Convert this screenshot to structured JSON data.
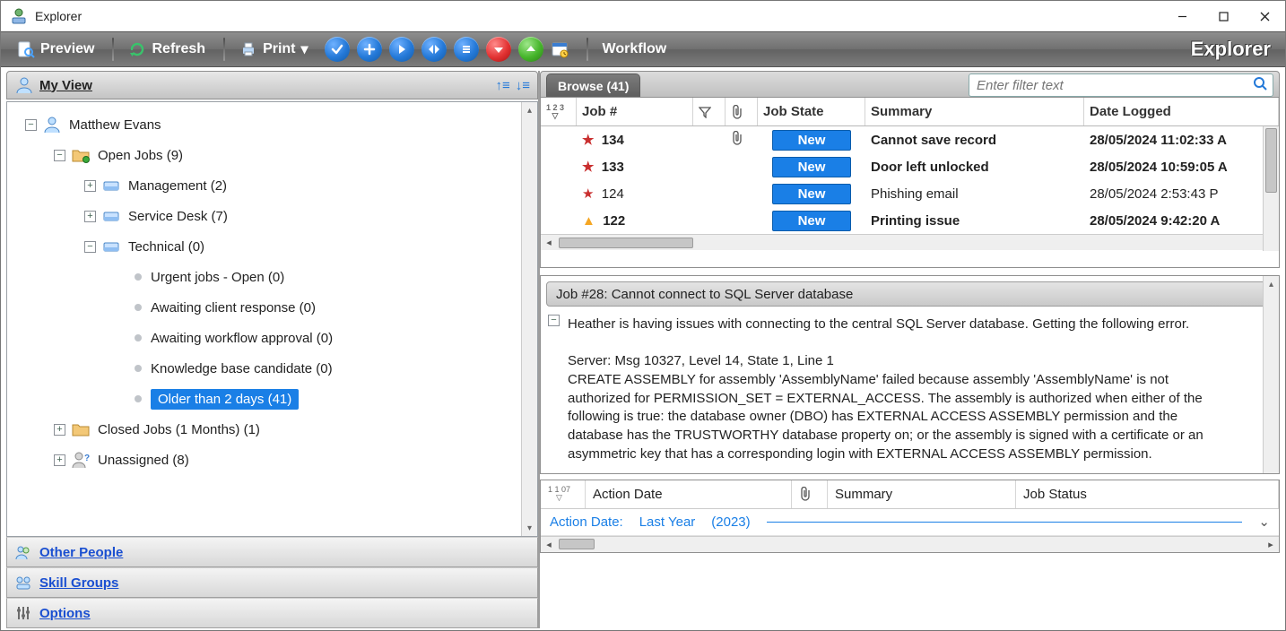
{
  "titlebar": {
    "title": "Explorer"
  },
  "toolbar": {
    "preview": "Preview",
    "refresh": "Refresh",
    "print": "Print",
    "workflow": "Workflow",
    "brand": "Explorer"
  },
  "sidebar": {
    "myview": {
      "label": "My View",
      "key": "M"
    },
    "user": "Matthew Evans",
    "open_jobs": "Open Jobs (9)",
    "management": "Management (2)",
    "service_desk": "Service Desk (7)",
    "technical": "Technical (0)",
    "tech_children": {
      "urgent": "Urgent jobs - Open (0)",
      "awaiting_client": "Awaiting client response (0)",
      "awaiting_wf": "Awaiting workflow approval (0)",
      "kb": "Knowledge base candidate (0)",
      "older": "Older than 2 days (41)"
    },
    "closed": "Closed Jobs (1 Months) (1)",
    "unassigned": "Unassigned (8)",
    "other_people": "Other People",
    "skill_groups": "Skill Groups",
    "options": "Options"
  },
  "browse": {
    "tab": "Browse (41)",
    "filter_placeholder": "Enter filter text",
    "cols": {
      "job": "Job #",
      "state": "Job State",
      "summary": "Summary",
      "date": "Date Logged"
    },
    "rows": [
      {
        "flag": "star",
        "job": "134",
        "clip": true,
        "state": "New",
        "summary": "Cannot save record",
        "date": "28/05/2024 11:02:33 A",
        "bold": true
      },
      {
        "flag": "star",
        "job": "133",
        "clip": false,
        "state": "New",
        "summary": "Door left unlocked",
        "date": "28/05/2024 10:59:05 A",
        "bold": true
      },
      {
        "flag": "star",
        "job": "124",
        "clip": false,
        "state": "New",
        "summary": "Phishing email",
        "date": "28/05/2024 2:53:43 P",
        "bold": false
      },
      {
        "flag": "warn",
        "job": "122",
        "clip": false,
        "state": "New",
        "summary": "Printing issue",
        "date": "28/05/2024 9:42:20 A",
        "bold": true
      }
    ]
  },
  "detail": {
    "title": "Job #28: Cannot connect to SQL Server database",
    "para1": "Heather is having issues with connecting to the central SQL Server database.   Getting the following error.",
    "para2": "Server: Msg 10327, Level 14, State 1, Line 1",
    "para3": "CREATE ASSEMBLY for assembly 'AssemblyName' failed because assembly 'AssemblyName' is not authorized for PERMISSION_SET = EXTERNAL_ACCESS. The assembly is authorized when either of the following is true: the database owner (DBO) has EXTERNAL ACCESS ASSEMBLY permission and the database has the TRUSTWORTHY database property on; or the assembly is signed with a certificate or an asymmetric key that has a corresponding login with EXTERNAL ACCESS ASSEMBLY permission."
  },
  "actions": {
    "cols": {
      "date": "Action Date",
      "summary": "Summary",
      "status": "Job Status"
    },
    "group": {
      "label": "Action Date:",
      "range": "Last Year",
      "year": "(2023)"
    }
  }
}
